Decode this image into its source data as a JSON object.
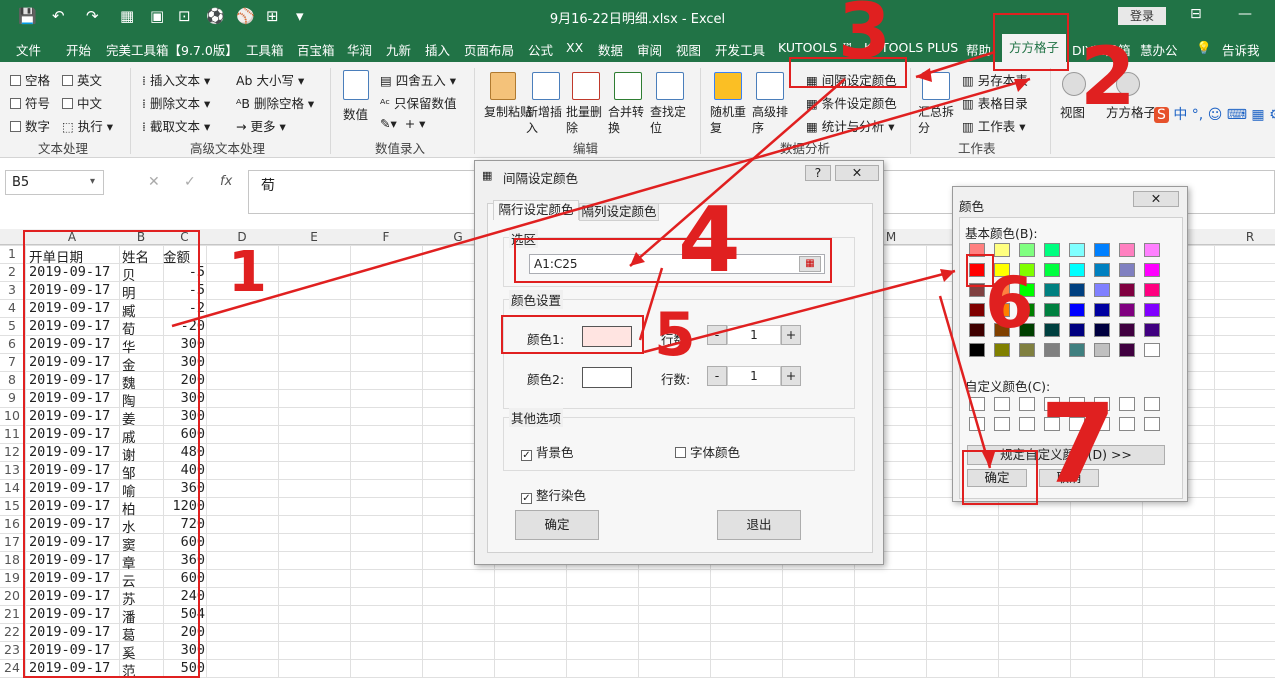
{
  "title": "9月16-22日明细.xlsx  -  Excel",
  "login": "登录",
  "menu": [
    "文件",
    "开始",
    "完美工具箱【9.7.0版】",
    "工具箱",
    "百宝箱",
    "华润",
    "九新",
    "插入",
    "页面布局",
    "公式",
    "XX",
    "数据",
    "审阅",
    "视图",
    "开发工具",
    "KUTOOLS ™",
    "KUTOOLS PLUS",
    "帮助",
    "DIY工具箱",
    "慧办公",
    "告诉我"
  ],
  "active_tab": "方方格子",
  "ribbon": {
    "text_proc": {
      "items": [
        "空格",
        "英文",
        "符号",
        "中文",
        "数字",
        "执行"
      ],
      "group": "文本处理"
    },
    "adv_text": {
      "items": [
        "插入文本",
        "大小写",
        "删除文本",
        "删除空格",
        "截取文本",
        "更多"
      ],
      "group": "高级文本处理"
    },
    "num_input": {
      "items": [
        "数值",
        "四舍五入",
        "只保留数值"
      ],
      "group": "数值录入"
    },
    "edit": {
      "items": [
        "复制粘贴",
        "新增插入",
        "批量删除",
        "合并转换",
        "查找定位"
      ],
      "group": "编辑"
    },
    "analysis": {
      "items": [
        "随机重复",
        "高级排序",
        "间隔设定颜色",
        "条件设定颜色",
        "统计与分析"
      ],
      "group": "数据分析"
    },
    "sheet": {
      "items": [
        "汇总拆分",
        "另存本表",
        "表格目录",
        "工作表"
      ],
      "group": "工作表"
    },
    "view": {
      "items": [
        "视图",
        "方方格子"
      ]
    }
  },
  "namebox": "B5",
  "formula": "荀",
  "columns": [
    "A",
    "B",
    "C",
    "D",
    "E",
    "F",
    "G",
    "M",
    "R"
  ],
  "headers": [
    "开单日期",
    "姓名",
    "金额"
  ],
  "rows": [
    [
      "2019-09-17",
      "贝",
      "-5"
    ],
    [
      "2019-09-17",
      "明",
      "-5"
    ],
    [
      "2019-09-17",
      "臧",
      "-2"
    ],
    [
      "2019-09-17",
      "荀",
      "-20"
    ],
    [
      "2019-09-17",
      "华",
      "300"
    ],
    [
      "2019-09-17",
      "金",
      "300"
    ],
    [
      "2019-09-17",
      "魏",
      "200"
    ],
    [
      "2019-09-17",
      "陶",
      "300"
    ],
    [
      "2019-09-17",
      "姜",
      "300"
    ],
    [
      "2019-09-17",
      "戚",
      "600"
    ],
    [
      "2019-09-17",
      "谢",
      "480"
    ],
    [
      "2019-09-17",
      "邹",
      "400"
    ],
    [
      "2019-09-17",
      "喻",
      "360"
    ],
    [
      "2019-09-17",
      "柏",
      "1200"
    ],
    [
      "2019-09-17",
      "水",
      "720"
    ],
    [
      "2019-09-17",
      "窦",
      "600"
    ],
    [
      "2019-09-17",
      "章",
      "360"
    ],
    [
      "2019-09-17",
      "云",
      "600"
    ],
    [
      "2019-09-17",
      "苏",
      "240"
    ],
    [
      "2019-09-17",
      "潘",
      "504"
    ],
    [
      "2019-09-17",
      "葛",
      "200"
    ],
    [
      "2019-09-17",
      "奚",
      "300"
    ],
    [
      "2019-09-17",
      "范",
      "500"
    ]
  ],
  "dialog1": {
    "title": "间隔设定颜色",
    "help": "?",
    "tabs": [
      "隔行设定颜色",
      "隔列设定颜色"
    ],
    "range_label": "选区",
    "range_value": "A1:C25",
    "color_settings": "颜色设置",
    "color1": "颜色1:",
    "color2": "颜色2:",
    "rows_label": "行数:",
    "rows1": "1",
    "rows2": "1",
    "minus": "-",
    "plus": "+",
    "other": "其他选项",
    "bg": "背景色",
    "fontcolor": "字体颜色",
    "wholerow": "整行染色",
    "ok": "确定",
    "exit": "退出",
    "color1_hex": "#ffe4e1"
  },
  "dialog2": {
    "title": "颜色",
    "basic": "基本颜色(B):",
    "custom": "自定义颜色(C):",
    "define": "规定自定义颜色(D) >>",
    "ok": "确定",
    "cancel": "取消",
    "colors": [
      "#ff8080",
      "#ffff80",
      "#80ff80",
      "#00ff80",
      "#80ffff",
      "#0080ff",
      "#ff80c0",
      "#ff80ff",
      "#ff0000",
      "#ffff00",
      "#80ff00",
      "#00ff40",
      "#00ffff",
      "#0080c0",
      "#8080c0",
      "#ff00ff",
      "#804040",
      "#ff8040",
      "#00ff00",
      "#008080",
      "#004080",
      "#8080ff",
      "#800040",
      "#ff0080",
      "#800000",
      "#ff8000",
      "#008000",
      "#008040",
      "#0000ff",
      "#0000a0",
      "#800080",
      "#8000ff",
      "#400000",
      "#804000",
      "#004000",
      "#004040",
      "#000080",
      "#000040",
      "#400040",
      "#400080",
      "#000000",
      "#808000",
      "#808040",
      "#808080",
      "#408080",
      "#c0c0c0",
      "#400040",
      "#ffffff"
    ]
  },
  "annotations": [
    "1",
    "2",
    "3",
    "4",
    "5",
    "6",
    "7"
  ]
}
